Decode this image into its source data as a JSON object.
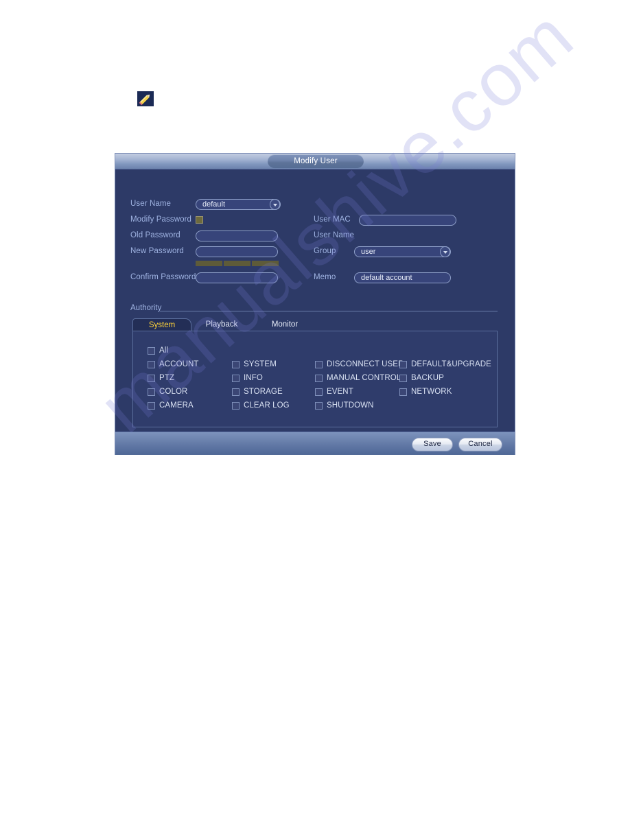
{
  "page": {
    "watermark": "manualshive.com",
    "background_color": "#ffffff"
  },
  "edit_icon": {
    "name": "pencil-edit-icon",
    "box_color": "#1b2a55",
    "pencil_color": "#f2d049"
  },
  "dialog": {
    "title": "Modify User",
    "background_color": "#2d3a67",
    "accent_color": "#ffd33a",
    "label_color": "#9fb3e2",
    "form": {
      "left_column": [
        {
          "label": "User Name",
          "type": "select",
          "value": "default"
        },
        {
          "label": "Modify Password",
          "type": "checkbox",
          "checked": false
        },
        {
          "label": "Old Password",
          "type": "input",
          "value": ""
        },
        {
          "label": "New Password",
          "type": "input",
          "value": ""
        },
        {
          "label": "Confirm Password",
          "type": "input",
          "value": ""
        }
      ],
      "password_strength_segments": 3,
      "right_column": [
        {
          "label": "User MAC",
          "type": "input",
          "value": ""
        },
        {
          "label": "User Name",
          "type": "text",
          "value": ""
        },
        {
          "label": "Group",
          "type": "select",
          "value": "user"
        },
        {
          "label": "Memo",
          "type": "input",
          "value": "default account"
        }
      ]
    },
    "authority": {
      "section_label": "Authority",
      "tabs": [
        {
          "label": "System",
          "active": true
        },
        {
          "label": "Playback",
          "active": false
        },
        {
          "label": "Monitor",
          "active": false
        }
      ],
      "select_all": {
        "label": "All",
        "checked": false
      },
      "permissions": [
        [
          {
            "label": "ACCOUNT",
            "checked": false
          },
          {
            "label": "PTZ",
            "checked": false
          },
          {
            "label": "COLOR",
            "checked": false
          },
          {
            "label": "CAMERA",
            "checked": false
          }
        ],
        [
          {
            "label": "SYSTEM",
            "checked": false
          },
          {
            "label": "INFO",
            "checked": false
          },
          {
            "label": "STORAGE",
            "checked": false
          },
          {
            "label": "CLEAR LOG",
            "checked": false
          }
        ],
        [
          {
            "label": "DISCONNECT USER",
            "checked": false
          },
          {
            "label": "MANUAL CONTROL",
            "checked": false
          },
          {
            "label": "EVENT",
            "checked": false
          },
          {
            "label": "SHUTDOWN",
            "checked": false
          }
        ],
        [
          {
            "label": "DEFAULT&UPGRADE",
            "checked": false
          },
          {
            "label": "BACKUP",
            "checked": false
          },
          {
            "label": "NETWORK",
            "checked": false
          }
        ]
      ]
    },
    "footer": {
      "save_label": "Save",
      "cancel_label": "Cancel"
    }
  }
}
